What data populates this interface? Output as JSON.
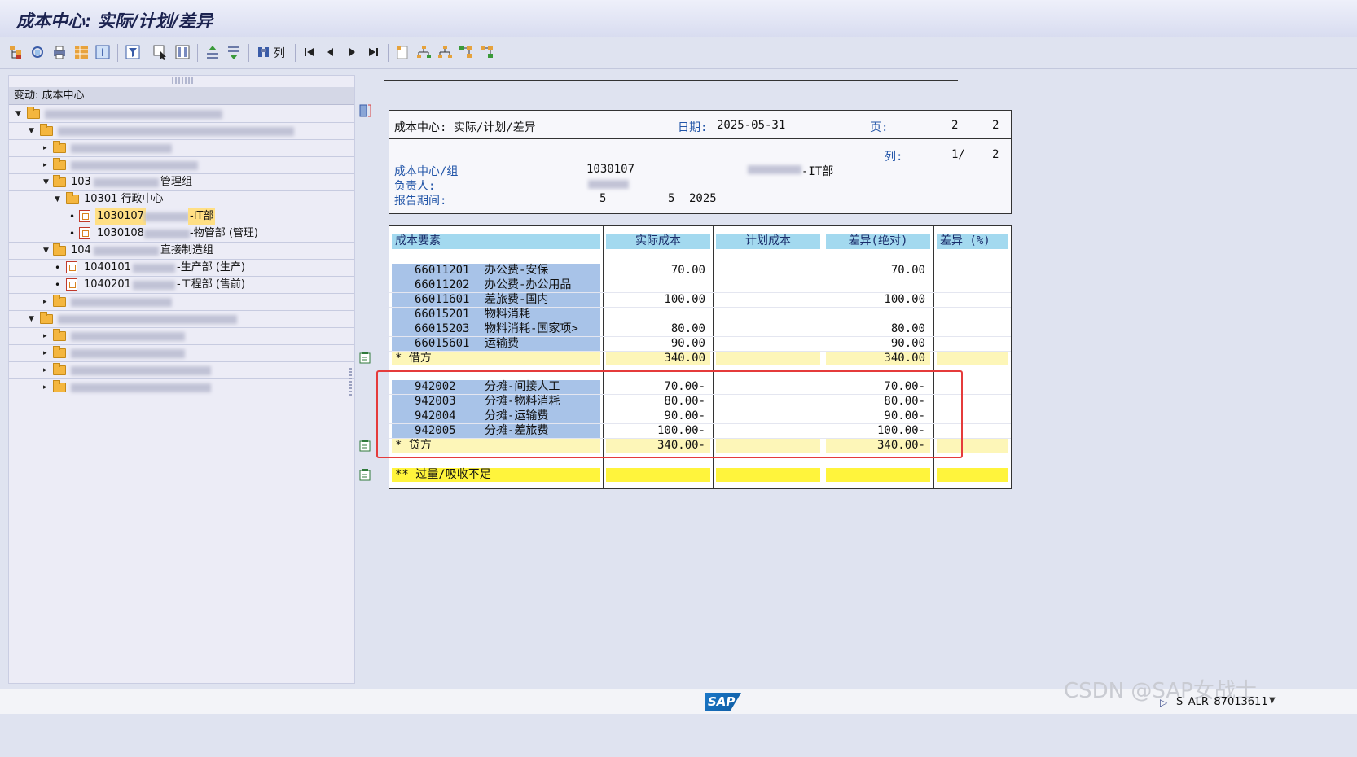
{
  "window": {
    "title": "成本中心: 实际/计划/差异"
  },
  "toolbar": {
    "columns_label": "列"
  },
  "tree": {
    "header": "变动: 成本中心",
    "nodes": {
      "n103": {
        "code": "103",
        "suffix": "管理组"
      },
      "n10301": {
        "label": "10301 行政中心"
      },
      "n1030107": {
        "code": "1030107",
        "suffix": "-IT部"
      },
      "n1030108": {
        "code": "1030108",
        "suffix": "-物管部 (管理)"
      },
      "n104": {
        "code": "104",
        "suffix": "直接制造组"
      },
      "n1040101": {
        "code": "1040101",
        "suffix": "-生产部 (生产)"
      },
      "n1040201": {
        "code": "1040201",
        "suffix": "-工程部 (售前)"
      }
    }
  },
  "header": {
    "title": "成本中心: 实际/计划/差异",
    "date_label": "日期:",
    "date_value": "2025-05-31",
    "page_label": "页:",
    "page_value": "2",
    "page_total": "2",
    "col_label": "列:",
    "col_value": "1/",
    "col_total": "2",
    "cc_label": "成本中心/组",
    "cc_value": "1030107",
    "cc_name": "-IT部",
    "owner_label": "负责人:",
    "period_label": "报告期间:",
    "period_from": "5",
    "period_to": "5",
    "period_year": "2025"
  },
  "report": {
    "columns": [
      "成本要素",
      "实际成本",
      "计划成本",
      "差异(绝对)",
      "差异 (%)"
    ],
    "debit_rows": [
      {
        "code": "66011201",
        "name": "办公费-安保",
        "actual": "70.00",
        "plan": "",
        "var": "70.00"
      },
      {
        "code": "66011202",
        "name": "办公费-办公用品",
        "actual": "",
        "plan": "",
        "var": ""
      },
      {
        "code": "66011601",
        "name": "差旅费-国内",
        "actual": "100.00",
        "plan": "",
        "var": "100.00"
      },
      {
        "code": "66015201",
        "name": "物料消耗",
        "actual": "",
        "plan": "",
        "var": ""
      },
      {
        "code": "66015203",
        "name": "物料消耗-国家项>",
        "actual": "80.00",
        "plan": "",
        "var": "80.00"
      },
      {
        "code": "66015601",
        "name": "运输费",
        "actual": "90.00",
        "plan": "",
        "var": "90.00"
      }
    ],
    "debit_total": {
      "label": "*  借方",
      "actual": "340.00",
      "var": "340.00"
    },
    "credit_rows": [
      {
        "code": "942002",
        "name": "分摊-间接人工",
        "actual": "70.00-",
        "var": "70.00-"
      },
      {
        "code": "942003",
        "name": "分摊-物料消耗",
        "actual": "80.00-",
        "var": "80.00-"
      },
      {
        "code": "942004",
        "name": "分摊-运输费",
        "actual": "90.00-",
        "var": "90.00-"
      },
      {
        "code": "942005",
        "name": "分摊-差旅费",
        "actual": "100.00-",
        "var": "100.00-"
      }
    ],
    "credit_total": {
      "label": "*  贷方",
      "actual": "340.00-",
      "var": "340.00-"
    },
    "grand_total": {
      "label": "** 过量/吸收不足"
    }
  },
  "status": {
    "sap_logo": "SAP",
    "watermark": "CSDN @SAP女战士",
    "tcode": "S_ALR_87013611"
  }
}
